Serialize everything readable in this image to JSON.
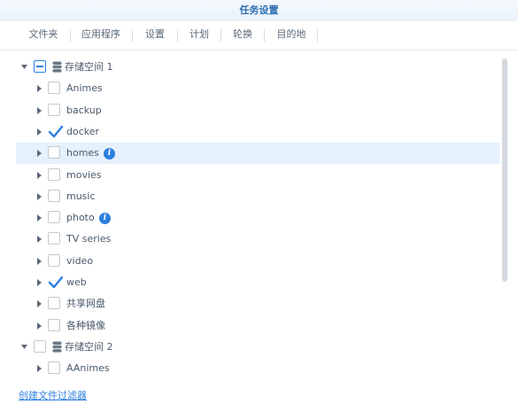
{
  "window": {
    "title": "任务设置"
  },
  "tabs": [
    {
      "label": "文件夹",
      "active": true
    },
    {
      "label": "应用程序",
      "active": false
    },
    {
      "label": "设置",
      "active": false
    },
    {
      "label": "计划",
      "active": false
    },
    {
      "label": "轮换",
      "active": false
    },
    {
      "label": "目的地",
      "active": false
    }
  ],
  "tree": {
    "rows": [
      {
        "label": "存储空间 1",
        "level": 0,
        "expanded": true,
        "state": "indeterminate",
        "volume": true,
        "info": false,
        "highlight": false
      },
      {
        "label": "Animes",
        "level": 1,
        "expanded": false,
        "state": "unchecked",
        "volume": false,
        "info": false,
        "highlight": false
      },
      {
        "label": "backup",
        "level": 1,
        "expanded": false,
        "state": "unchecked",
        "volume": false,
        "info": false,
        "highlight": false
      },
      {
        "label": "docker",
        "level": 1,
        "expanded": false,
        "state": "checked",
        "volume": false,
        "info": false,
        "highlight": false
      },
      {
        "label": "homes",
        "level": 1,
        "expanded": false,
        "state": "unchecked",
        "volume": false,
        "info": true,
        "highlight": true
      },
      {
        "label": "movies",
        "level": 1,
        "expanded": false,
        "state": "unchecked",
        "volume": false,
        "info": false,
        "highlight": false
      },
      {
        "label": "music",
        "level": 1,
        "expanded": false,
        "state": "unchecked",
        "volume": false,
        "info": false,
        "highlight": false
      },
      {
        "label": "photo",
        "level": 1,
        "expanded": false,
        "state": "unchecked",
        "volume": false,
        "info": true,
        "highlight": false
      },
      {
        "label": "TV series",
        "level": 1,
        "expanded": false,
        "state": "unchecked",
        "volume": false,
        "info": false,
        "highlight": false
      },
      {
        "label": "video",
        "level": 1,
        "expanded": false,
        "state": "unchecked",
        "volume": false,
        "info": false,
        "highlight": false
      },
      {
        "label": "web",
        "level": 1,
        "expanded": false,
        "state": "checked",
        "volume": false,
        "info": false,
        "highlight": false
      },
      {
        "label": "共享网盘",
        "level": 1,
        "expanded": false,
        "state": "unchecked",
        "volume": false,
        "info": false,
        "highlight": false
      },
      {
        "label": "各种镜像",
        "level": 1,
        "expanded": false,
        "state": "unchecked",
        "volume": false,
        "info": false,
        "highlight": false
      },
      {
        "label": "存储空间 2",
        "level": 0,
        "expanded": true,
        "state": "unchecked",
        "volume": true,
        "info": false,
        "highlight": false
      },
      {
        "label": "AAnimes",
        "level": 1,
        "expanded": false,
        "state": "unchecked",
        "volume": false,
        "info": false,
        "highlight": false
      }
    ]
  },
  "footer": {
    "link_label": "创建文件过滤器"
  },
  "colors": {
    "accent": "#2d7fe0",
    "highlight": "#e5f1fc",
    "title": "#2f6fb3"
  }
}
